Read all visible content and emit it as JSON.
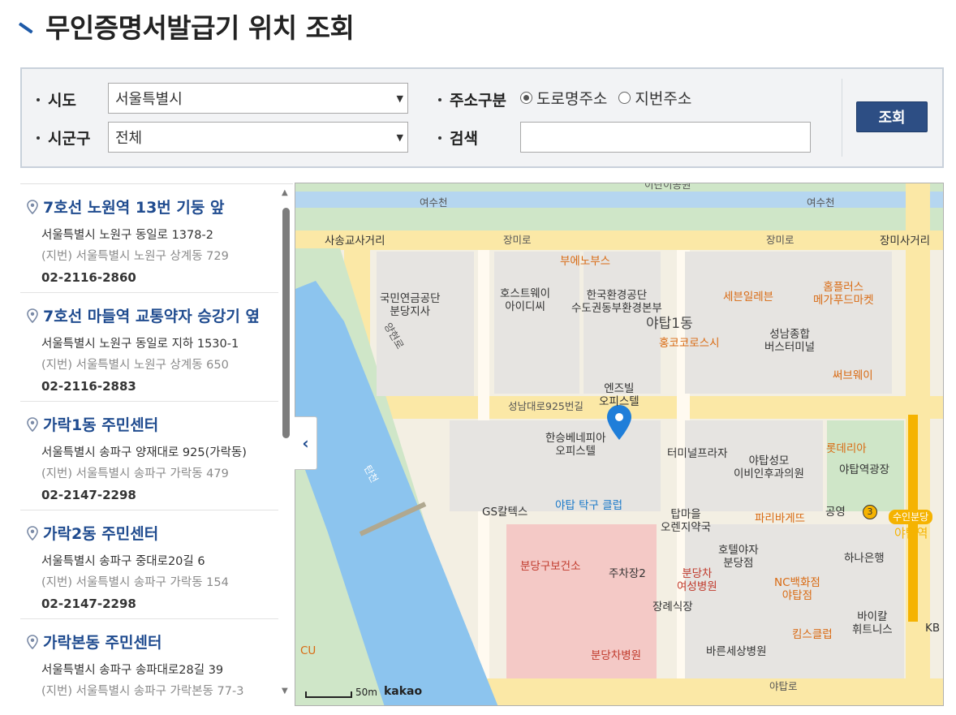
{
  "page": {
    "title": "무인증명서발급기 위치 조회"
  },
  "search": {
    "sido_label": "시도",
    "sido_value": "서울특별시",
    "sigungu_label": "시군구",
    "sigungu_value": "전체",
    "addr_type_label": "주소구분",
    "addr_options": [
      "도로명주소",
      "지번주소"
    ],
    "addr_selected": "도로명주소",
    "keyword_label": "검색",
    "keyword_value": "",
    "submit_label": "조회"
  },
  "results": [
    {
      "name": "7호선 노원역 13번 기둥 앞",
      "road_address": "서울특별시 노원구 동일로 1378-2",
      "jibun_address": "(지번) 서울특별시 노원구 상계동 729",
      "phone": "02-2116-2860"
    },
    {
      "name": "7호선 마들역 교통약자 승강기 옆",
      "road_address": "서울특별시 노원구 동일로 지하 1530-1",
      "jibun_address": "(지번) 서울특별시 노원구 상계동 650",
      "phone": "02-2116-2883"
    },
    {
      "name": "가락1동 주민센터",
      "road_address": "서울특별시 송파구 양재대로 925(가락동)",
      "jibun_address": "(지번) 서울특별시 송파구 가락동 479",
      "phone": "02-2147-2298"
    },
    {
      "name": "가락2동 주민센터",
      "road_address": "서울특별시 송파구 중대로20길 6",
      "jibun_address": "(지번) 서울특별시 송파구 가락동 154",
      "phone": "02-2147-2298"
    },
    {
      "name": "가락본동 주민센터",
      "road_address": "서울특별시 송파구 송파대로28길 39",
      "jibun_address": "(지번) 서울특별시 송파구 가락본동 77-3",
      "phone": "02-2147-2298"
    }
  ],
  "map": {
    "scale_label": "50m",
    "brand": "kakao",
    "labels": {
      "yeosucheon_1": "여수천",
      "yeosucheon_2": "여수천",
      "top_cut": "이란이공원",
      "sasong": "사송교사거리",
      "jangmiro_1": "장미로",
      "jangmiro_2": "장미로",
      "jangmi_sa": "장미사거리",
      "nps_1": "국민연금공단",
      "nps_2": "분당지사",
      "host_1": "호스트웨이",
      "host_2": "아이디씨",
      "buenos": "부에노부스",
      "env_1": "한국환경공단",
      "env_2": "수도권동부환경본부",
      "yatap1": "야탑1동",
      "seven": "세븐일레븐",
      "home_1": "홈플러스",
      "home_2": "메가푸드마켓",
      "hongkong": "홍코코로스시",
      "terminal_1": "성남종합",
      "terminal_2": "버스터미널",
      "subway": "써브웨이",
      "yangheon": "양현로",
      "nsbil_1": "엔즈빌",
      "nsbil_2": "오피스텔",
      "seongnam": "성남대로925번길",
      "hanseung_1": "한승베네피아",
      "hanseung_2": "오피스텔",
      "terminal_plaza": "터미널프라자",
      "yatap_eye_1": "야탑성모",
      "yatap_eye_2": "이비인후과의원",
      "lotteria": "롯데리아",
      "yatap_square": "야탑역광장",
      "tancheon": "탄천",
      "gs": "GS칼텍스",
      "pingpong": "야탑 탁구 클럽",
      "tapmaeul_1": "탑마을",
      "tapmaeul_2": "오렌지약국",
      "paris": "파리바게뜨",
      "gongyeong": "공영",
      "line3": "3",
      "suin": "수인분당",
      "yatap_st": "야탑역",
      "health": "분당구보건소",
      "parking2": "주차장2",
      "hotel_1": "호텔야자",
      "hotel_2": "분당점",
      "wh_1": "분당차",
      "wh_2": "여성병원",
      "nc_1": "NC백화점",
      "nc_2": "야탑점",
      "hana": "하나은행",
      "funeral": "장례식장",
      "kims": "킴스클럽",
      "bio_1": "바이칼",
      "bio_2": "휘트니스",
      "kb": "KB",
      "cu": "CU",
      "cha": "분당차병원",
      "bareun": "바른세상병원",
      "yatapro": "야탑로"
    }
  }
}
